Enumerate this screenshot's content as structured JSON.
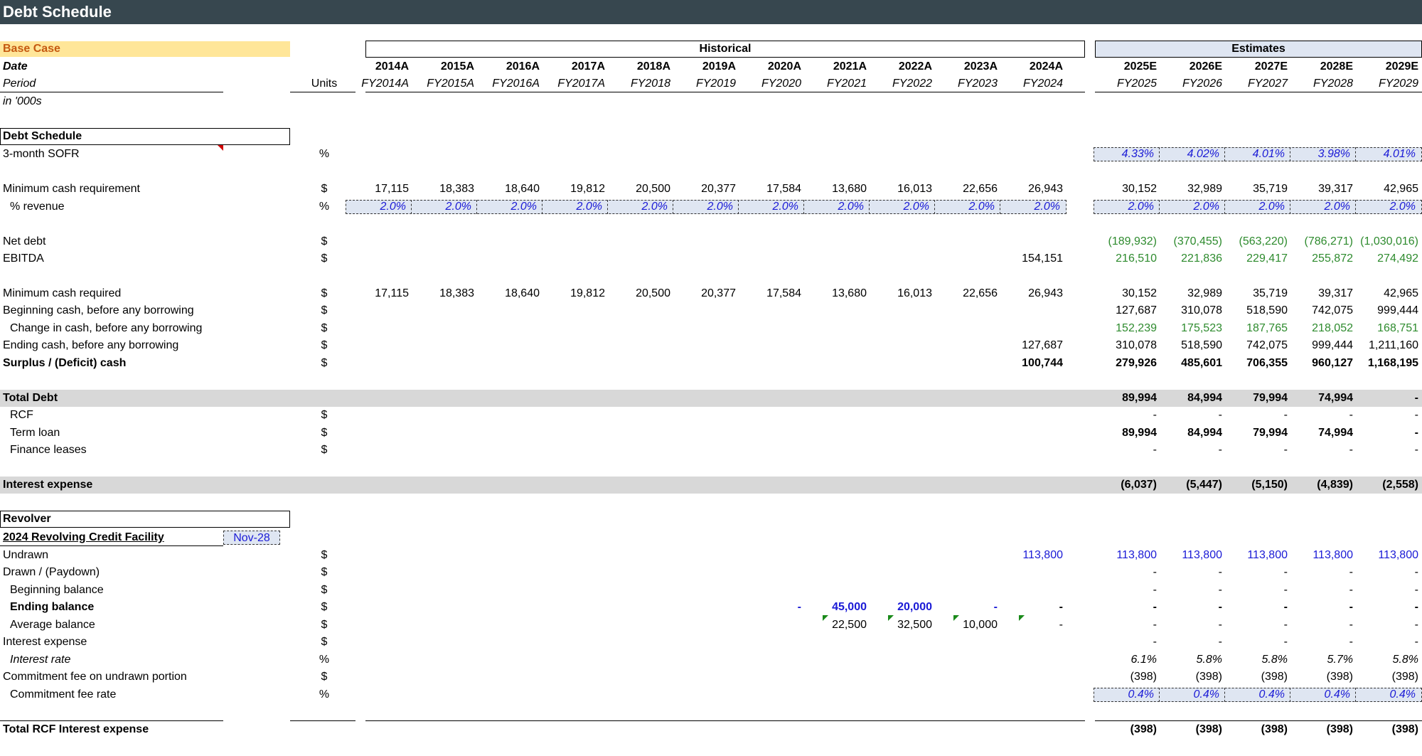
{
  "title": "Debt Schedule",
  "scenario": "Base Case",
  "header_labels": {
    "date": "Date",
    "period": "Period",
    "units_note": "in '000s",
    "units": "Units"
  },
  "groups": {
    "historical": "Historical",
    "estimates": "Estimates"
  },
  "years": [
    "2014A",
    "2015A",
    "2016A",
    "2017A",
    "2018A",
    "2019A",
    "2020A",
    "2021A",
    "2022A",
    "2023A",
    "2024A",
    "2025E",
    "2026E",
    "2027E",
    "2028E",
    "2029E"
  ],
  "periods": [
    "FY2014A",
    "FY2015A",
    "FY2016A",
    "FY2017A",
    "FY2018",
    "FY2019",
    "FY2020",
    "FY2021",
    "FY2022",
    "FY2023",
    "FY2024",
    "FY2025",
    "FY2026",
    "FY2027",
    "FY2028",
    "FY2029"
  ],
  "sections": {
    "debt_schedule": "Debt Schedule",
    "revolver": "Revolver"
  },
  "rcf": {
    "title": "2024 Revolving Credit Facility",
    "maturity": "Nov-28"
  },
  "rows": [
    {
      "id": "sofr",
      "label": "3-month SOFR",
      "unit": "%",
      "style": "",
      "indent": 0,
      "vals": [
        "",
        "",
        "",
        "",
        "",
        "",
        "",
        "",
        "",
        "",
        "",
        "4.33%",
        "4.02%",
        "4.01%",
        "3.98%",
        "4.01%"
      ],
      "color": "blue",
      "input": "est"
    },
    {
      "id": "min-cash",
      "label": "Minimum cash requirement",
      "unit": "$",
      "style": "",
      "indent": 0,
      "vals": [
        "17,115",
        "18,383",
        "18,640",
        "19,812",
        "20,500",
        "20,377",
        "17,584",
        "13,680",
        "16,013",
        "22,656",
        "26,943",
        "30,152",
        "32,989",
        "35,719",
        "39,317",
        "42,965"
      ]
    },
    {
      "id": "pct-rev",
      "label": "% revenue",
      "unit": "%",
      "style": "",
      "indent": 1,
      "vals": [
        "2.0%",
        "2.0%",
        "2.0%",
        "2.0%",
        "2.0%",
        "2.0%",
        "2.0%",
        "2.0%",
        "2.0%",
        "2.0%",
        "2.0%",
        "2.0%",
        "2.0%",
        "2.0%",
        "2.0%",
        "2.0%"
      ],
      "color": "blue",
      "input": "all"
    },
    {
      "id": "net-debt",
      "label": "Net debt",
      "unit": "$",
      "style": "",
      "indent": 0,
      "vals": [
        "",
        "",
        "",
        "",
        "",
        "",
        "",
        "",
        "",
        "",
        "",
        "(189,932)",
        "(370,455)",
        "(563,220)",
        "(786,271)",
        "(1,030,016)"
      ],
      "color": "green"
    },
    {
      "id": "ebitda",
      "label": "EBITDA",
      "unit": "$",
      "style": "",
      "indent": 0,
      "vals": [
        "",
        "",
        "",
        "",
        "",
        "",
        "",
        "",
        "",
        "",
        "154,151",
        "216,510",
        "221,836",
        "229,417",
        "255,872",
        "274,492"
      ],
      "colorEst": "green"
    },
    {
      "id": "min-cash-req",
      "label": "Minimum cash required",
      "unit": "$",
      "style": "",
      "indent": 0,
      "vals": [
        "17,115",
        "18,383",
        "18,640",
        "19,812",
        "20,500",
        "20,377",
        "17,584",
        "13,680",
        "16,013",
        "22,656",
        "26,943",
        "30,152",
        "32,989",
        "35,719",
        "39,317",
        "42,965"
      ]
    },
    {
      "id": "beg-cash",
      "label": "Beginning cash, before any borrowing",
      "unit": "$",
      "style": "",
      "indent": 0,
      "vals": [
        "",
        "",
        "",
        "",
        "",
        "",
        "",
        "",
        "",
        "",
        "",
        "127,687",
        "310,078",
        "518,590",
        "742,075",
        "999,444"
      ]
    },
    {
      "id": "chg-cash",
      "label": "Change in cash, before any  borrowing",
      "unit": "$",
      "style": "",
      "indent": 1,
      "vals": [
        "",
        "",
        "",
        "",
        "",
        "",
        "",
        "",
        "",
        "",
        "",
        "152,239",
        "175,523",
        "187,765",
        "218,052",
        "168,751"
      ],
      "color": "green"
    },
    {
      "id": "end-cash",
      "label": "Ending cash, before any borrowing",
      "unit": "$",
      "style": "",
      "indent": 0,
      "vals": [
        "",
        "",
        "",
        "",
        "",
        "",
        "",
        "",
        "",
        "",
        "127,687",
        "310,078",
        "518,590",
        "742,075",
        "999,444",
        "1,211,160"
      ]
    },
    {
      "id": "surplus",
      "label": "Surplus / (Deficit) cash",
      "unit": "$",
      "style": "bold",
      "indent": 0,
      "vals": [
        "",
        "",
        "",
        "",
        "",
        "",
        "",
        "",
        "",
        "",
        "100,744",
        "279,926",
        "485,601",
        "706,355",
        "960,127",
        "1,168,195"
      ]
    },
    {
      "id": "total-debt",
      "label": "Total Debt",
      "unit": "",
      "style": "bold",
      "indent": 0,
      "band": true,
      "vals": [
        "",
        "",
        "",
        "",
        "",
        "",
        "",
        "",
        "",
        "",
        "",
        "89,994",
        "84,994",
        "79,994",
        "74,994",
        "-"
      ]
    },
    {
      "id": "rcf",
      "label": "RCF",
      "unit": "$",
      "style": "",
      "indent": 1,
      "vals": [
        "",
        "",
        "",
        "",
        "",
        "",
        "",
        "",
        "",
        "",
        "",
        "-",
        "-",
        "-",
        "-",
        "-"
      ]
    },
    {
      "id": "term-loan",
      "label": "Term loan",
      "unit": "$",
      "style": "",
      "indent": 1,
      "valStyle": "bold",
      "vals": [
        "",
        "",
        "",
        "",
        "",
        "",
        "",
        "",
        "",
        "",
        "",
        "89,994",
        "84,994",
        "79,994",
        "74,994",
        "-"
      ]
    },
    {
      "id": "fin-leases",
      "label": "Finance leases",
      "unit": "$",
      "style": "",
      "indent": 1,
      "vals": [
        "",
        "",
        "",
        "",
        "",
        "",
        "",
        "",
        "",
        "",
        "",
        "-",
        "-",
        "-",
        "-",
        "-"
      ]
    },
    {
      "id": "int-exp",
      "label": "Interest expense",
      "unit": "",
      "style": "bold",
      "indent": 0,
      "band": true,
      "vals": [
        "",
        "",
        "",
        "",
        "",
        "",
        "",
        "",
        "",
        "",
        "",
        "(6,037)",
        "(5,447)",
        "(5,150)",
        "(4,839)",
        "(2,558)"
      ]
    },
    {
      "id": "undrawn",
      "label": "Undrawn",
      "unit": "$",
      "style": "",
      "indent": 0,
      "color": "blue",
      "vals": [
        "",
        "",
        "",
        "",
        "",
        "",
        "",
        "",
        "",
        "",
        "113,800",
        "113,800",
        "113,800",
        "113,800",
        "113,800",
        "113,800"
      ]
    },
    {
      "id": "drawn",
      "label": "Drawn / (Paydown)",
      "unit": "$",
      "style": "",
      "indent": 0,
      "vals": [
        "",
        "",
        "",
        "",
        "",
        "",
        "",
        "",
        "",
        "",
        "",
        "-",
        "-",
        "-",
        "-",
        "-"
      ]
    },
    {
      "id": "beg-bal",
      "label": "Beginning balance",
      "unit": "$",
      "style": "",
      "indent": 1,
      "vals": [
        "",
        "",
        "",
        "",
        "",
        "",
        "",
        "",
        "",
        "",
        "",
        "-",
        "-",
        "-",
        "-",
        "-"
      ]
    },
    {
      "id": "end-bal",
      "label": "Ending balance",
      "unit": "$",
      "style": "bold",
      "indent": 1,
      "valStyle": "bold",
      "vals": [
        "",
        "",
        "",
        "",
        "",
        "",
        "-",
        "45,000",
        "20,000",
        "-",
        "-",
        "-",
        "-",
        "-",
        "-",
        "-"
      ],
      "colorHist": "blue"
    },
    {
      "id": "avg-bal",
      "label": "Average balance",
      "unit": "$",
      "style": "",
      "indent": 1,
      "vals": [
        "",
        "",
        "",
        "",
        "",
        "",
        "",
        "22,500",
        "32,500",
        "10,000",
        "-",
        "-",
        "-",
        "-",
        "-",
        "-"
      ]
    },
    {
      "id": "rcf-int",
      "label": "Interest expense",
      "unit": "$",
      "style": "",
      "indent": 0,
      "vals": [
        "",
        "",
        "",
        "",
        "",
        "",
        "",
        "",
        "",
        "",
        "",
        "-",
        "-",
        "-",
        "-",
        "-"
      ]
    },
    {
      "id": "int-rate",
      "label": "Interest rate",
      "unit": "%",
      "style": "ital",
      "indent": 1,
      "valStyle": "ital",
      "vals": [
        "",
        "",
        "",
        "",
        "",
        "",
        "",
        "",
        "",
        "",
        "",
        "6.1%",
        "5.8%",
        "5.8%",
        "5.7%",
        "5.8%"
      ]
    },
    {
      "id": "commit-fee",
      "label": "Commitment fee on undrawn portion",
      "unit": "$",
      "style": "",
      "indent": 0,
      "vals": [
        "",
        "",
        "",
        "",
        "",
        "",
        "",
        "",
        "",
        "",
        "",
        "(398)",
        "(398)",
        "(398)",
        "(398)",
        "(398)"
      ]
    },
    {
      "id": "commit-rate",
      "label": "Commitment fee rate",
      "unit": "%",
      "style": "",
      "indent": 1,
      "valStyle": "ital",
      "color": "blue",
      "input": "est",
      "vals": [
        "",
        "",
        "",
        "",
        "",
        "",
        "",
        "",
        "",
        "",
        "",
        "0.4%",
        "0.4%",
        "0.4%",
        "0.4%",
        "0.4%"
      ]
    },
    {
      "id": "total-rcf",
      "label": "Total RCF Interest expense",
      "unit": "",
      "style": "bold",
      "indent": 0,
      "valStyle": "bold",
      "vals": [
        "",
        "",
        "",
        "",
        "",
        "",
        "",
        "",
        "",
        "",
        "",
        "(398)",
        "(398)",
        "(398)",
        "(398)",
        "(398)"
      ]
    }
  ],
  "colors": {
    "title_bar": "#37474f",
    "scenario_fill": "#ffe699",
    "scenario_text": "#c55a11",
    "input_fill": "#dfe6f2",
    "band": "#d8d8d8",
    "blue": "#1a1ad6",
    "green": "#2e8b2e"
  }
}
